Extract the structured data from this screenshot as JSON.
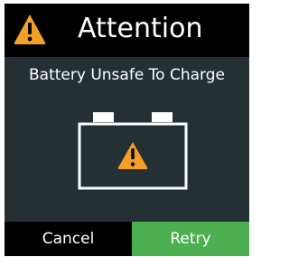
{
  "header": {
    "icon": "warning-triangle-icon",
    "title": "Attention"
  },
  "message": "Battery Unsafe To Charge",
  "illustration": {
    "icon": "battery-warning-icon"
  },
  "buttons": {
    "cancel_label": "Cancel",
    "retry_label": "Retry"
  },
  "colors": {
    "warning": "#f4a026",
    "retry": "#4caf50",
    "background": "#243034",
    "header": "#000000"
  }
}
